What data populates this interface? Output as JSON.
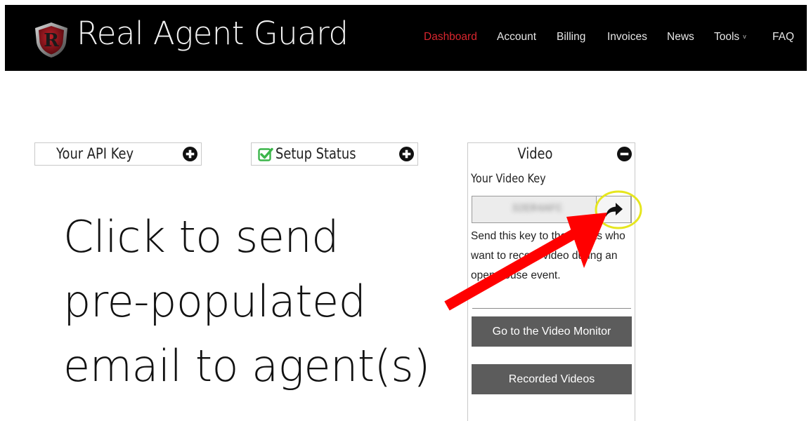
{
  "header": {
    "brand": "Real Agent Guard",
    "nav": [
      {
        "label": "Dashboard",
        "active": true
      },
      {
        "label": "Account"
      },
      {
        "label": "Billing"
      },
      {
        "label": "Invoices"
      },
      {
        "label": "News"
      },
      {
        "label": "Tools",
        "has_dropdown": true
      },
      {
        "label": "FAQ"
      }
    ],
    "logo_letter": "R"
  },
  "panels": {
    "api_key": {
      "title": "Your API Key",
      "state": "collapsed",
      "toggle_icon": "plus-circle-icon"
    },
    "setup_status": {
      "title": "Setup Status",
      "state": "collapsed",
      "status_icon": "check-square-icon",
      "toggle_icon": "plus-circle-icon"
    }
  },
  "video": {
    "title": "Video",
    "toggle_icon": "minus-circle-icon",
    "key_label": "Your Video Key",
    "key_value": "32ER4AFC",
    "share_icon": "share-arrow-icon",
    "description": "Send this key to the agents who want to record video during an open house event.",
    "buttons": {
      "monitor": "Go to the Video Monitor",
      "recorded": "Recorded Videos"
    }
  },
  "annotation": {
    "lines": [
      "Click to send",
      "pre-populated",
      "email to agent(s)"
    ],
    "arrow_color": "#ff0000",
    "highlight_color": "#e6e61e"
  },
  "colors": {
    "header_bg": "#000000",
    "nav_active": "#d9262e",
    "button_bg": "#5c5c5c",
    "check_green": "#3bb54a"
  }
}
